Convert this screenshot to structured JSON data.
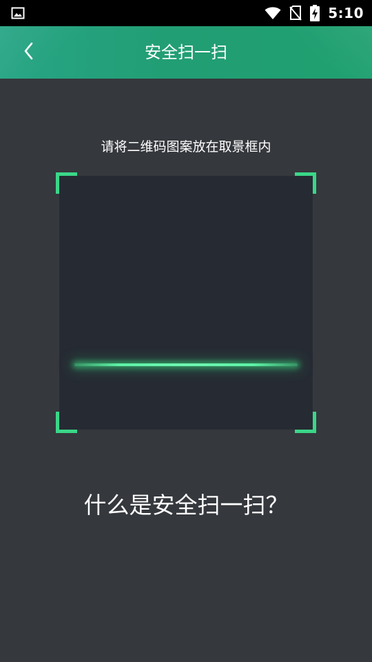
{
  "status_bar": {
    "time": "5:10",
    "icons": [
      "image-notification-icon",
      "wifi-icon",
      "no-sim-icon",
      "battery-charging-icon"
    ]
  },
  "header": {
    "title": "安全扫一扫",
    "back_icon": "chevron-left-icon"
  },
  "scanner": {
    "hint": "请将二维码图案放在取景框内",
    "accent_color": "#3ad788"
  },
  "footer": {
    "question": "什么是安全扫一扫？"
  },
  "colors": {
    "header_bg": "#229e74",
    "page_bg": "#35383d",
    "scan_area_bg": "#262b33"
  }
}
